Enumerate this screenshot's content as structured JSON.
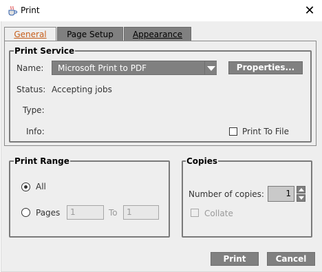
{
  "window": {
    "title": "Print",
    "close_glyph": "✕"
  },
  "tabs": [
    {
      "label": "General",
      "selected": true
    },
    {
      "label": "Page Setup",
      "selected": false
    },
    {
      "label": "Appearance",
      "selected": false
    }
  ],
  "print_service": {
    "legend": "Print Service",
    "name_label": "Name:",
    "printer_value": "Microsoft Print to PDF",
    "properties_label": "Properties...",
    "status_label": "Status:",
    "status_value": "Accepting jobs",
    "type_label": "Type:",
    "info_label": "Info:",
    "print_to_file_label": "Print To File",
    "print_to_file_checked": false
  },
  "print_range": {
    "legend": "Print Range",
    "all_label": "All",
    "all_selected": true,
    "pages_label": "Pages",
    "from_value": "1",
    "to_label": "To",
    "to_value": "1"
  },
  "copies": {
    "legend": "Copies",
    "number_label": "Number of copies:",
    "number_value": "1",
    "collate_label": "Collate",
    "collate_checked": false
  },
  "buttons": {
    "print_label": "Print",
    "cancel_label": "Cancel"
  },
  "icons": {
    "app": "java-cup-icon",
    "close": "close-icon",
    "dropdown": "dropdown-arrow-icon",
    "spin_up": "spin-up-icon",
    "spin_down": "spin-down-icon"
  },
  "colors": {
    "selected_tab_text": "#c75e1a",
    "button_bg": "#808080",
    "panel_bg": "#eeeeee"
  }
}
